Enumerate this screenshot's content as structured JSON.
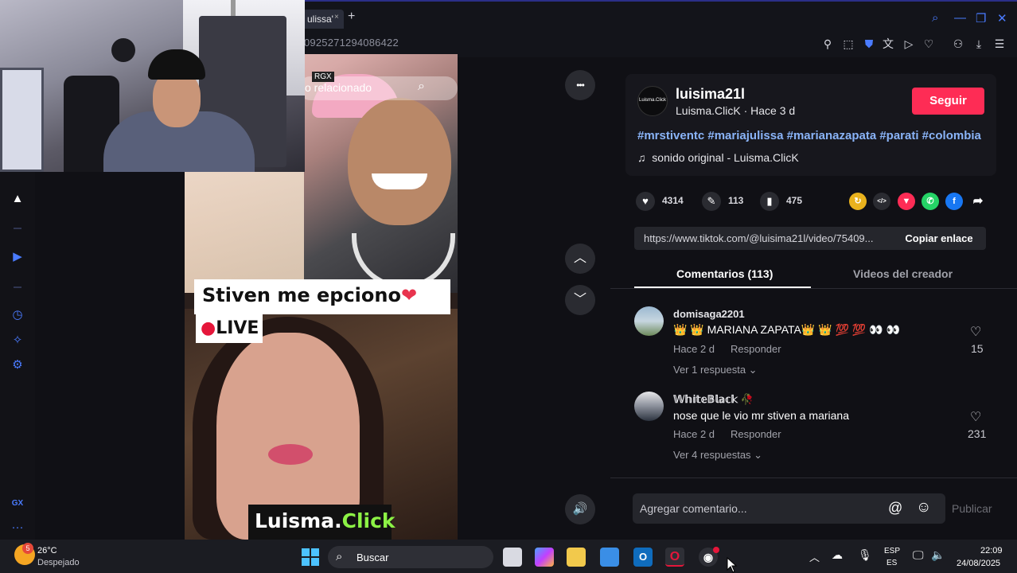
{
  "browser": {
    "tab_title": "ulissa'",
    "tab_close": "×",
    "new_tab": "+",
    "url": "0925271294086422"
  },
  "video": {
    "search_text": "o relacionado",
    "rgx_badge": "RGX",
    "caption_left": "Stiven me ",
    "caption_right": "epciono",
    "caption_heart": "❤",
    "live_dot": "●",
    "live_text": "LIVE",
    "brand_white": "Luisma.",
    "brand_green": "Click",
    "controls": {
      "more": "•••",
      "up": "︿",
      "down": "﹀",
      "volume": "🔊"
    }
  },
  "post": {
    "avatar_text": "Luisma.Click",
    "username": "luisima21l",
    "subline": "Luisma.ClicK · Hace 3 d",
    "follow_label": "Seguir",
    "hashtags": "#mrstiventc #mariajulissa #marianazapata #parati #colombia",
    "sound_icon": "♫",
    "sound": "sonido original - Luisma.ClicK"
  },
  "actions": {
    "likes": "4314",
    "comments": "113",
    "saves": "475"
  },
  "share_icons": [
    {
      "name": "gift",
      "glyph": "↻",
      "color": "#e9b21d"
    },
    {
      "name": "embed",
      "glyph": "</>",
      "color": "#2a2b31"
    },
    {
      "name": "send",
      "glyph": "▼",
      "color": "#fe2c55"
    },
    {
      "name": "whatsapp",
      "glyph": "✆",
      "color": "#25d366"
    },
    {
      "name": "facebook",
      "glyph": "f",
      "color": "#1877f2"
    },
    {
      "name": "share-arrow",
      "glyph": "➦",
      "color": "transparent"
    }
  ],
  "link": {
    "url": "https://www.tiktok.com/@luisima21l/video/75409...",
    "copy_label": "Copiar enlace"
  },
  "tabs": {
    "comments": "Comentarios (113)",
    "creator_videos": "Videos del creador"
  },
  "comments": [
    {
      "user": "domisaga2201",
      "text": "👑 👑  MARIANA ZAPATA👑 👑 💯 💯 👀 👀",
      "time": "Hace 2 d",
      "reply": "Responder",
      "likes": "15",
      "more": "Ver 1 respuesta ⌄"
    },
    {
      "user": "𝕎𝕙𝕚𝕥𝕖𝔹𝕝𝕒𝕔𝕜 🥀",
      "text": "nose que le vio mr stiven a mariana",
      "time": "Hace 2 d",
      "reply": "Responder",
      "likes": "231",
      "more": "Ver 4 respuestas ⌄"
    }
  ],
  "comment_input": {
    "placeholder": "Agregar comentario...",
    "at": "@",
    "emoji": "☺",
    "publish": "Publicar"
  },
  "sidebar": {
    "gx_label": "GX",
    "dots": "···"
  },
  "taskbar": {
    "weather_temp": "26°C",
    "weather_desc": "Despejado",
    "weather_badge": "5",
    "search": "Buscar",
    "lang_top": "ESP",
    "lang_bottom": "ES",
    "time": "22:09",
    "date": "24/08/2025"
  }
}
